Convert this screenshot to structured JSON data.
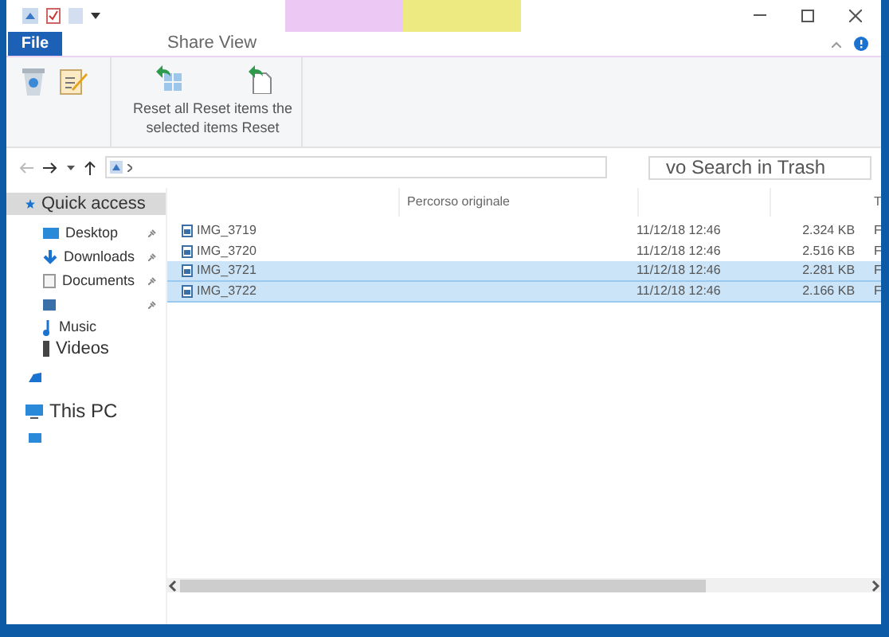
{
  "context_tabs": [
    {
      "color": "#ecc9f5"
    },
    {
      "color": "#eeea82"
    }
  ],
  "file_tab": {
    "label": "File"
  },
  "tabs": [
    {
      "label": "Share View",
      "selected": false
    }
  ],
  "ribbon": {
    "caption_lines": [
      "Reset all Reset items the",
      "selected items Reset"
    ]
  },
  "search": {
    "placeholder": "vo Search in Trash"
  },
  "nav_pane": {
    "items": [
      {
        "kind": "quick",
        "label": "Quick access",
        "selected": true
      },
      {
        "kind": "desktop",
        "label": "Desktop",
        "pinned": true,
        "selected": false
      },
      {
        "kind": "downloads",
        "label": "Downloads",
        "pinned": true,
        "selected": false
      },
      {
        "kind": "documents",
        "label": "Documents",
        "pinned": true,
        "selected": false
      },
      {
        "kind": "pictures",
        "pinned": true,
        "selected": false
      },
      {
        "kind": "music",
        "label": "Music",
        "pinned": false,
        "selected": false
      },
      {
        "kind": "videos",
        "label": "Videos",
        "pinned": false,
        "selected": false
      },
      {
        "kind": "cloud",
        "selected": false
      },
      {
        "kind": "pc",
        "label": "This PC",
        "selected": false
      },
      {
        "kind": "network",
        "selected": false
      }
    ]
  },
  "file_list": {
    "columns": [
      {},
      {
        "label": "Percorso originale"
      },
      {},
      {},
      {
        "label": "T"
      }
    ],
    "rows": [
      {
        "name": "IMG_3719",
        "date": "11/12/18 12:46",
        "size": "2.324 KB",
        "type": "F",
        "selected": false
      },
      {
        "name": "IMG_3720",
        "date": "11/12/18 12:46",
        "size": "2.516 KB",
        "type": "F",
        "selected": false
      },
      {
        "name": "IMG_3721",
        "date": "11/12/18 12:46",
        "size": "2.281 KB",
        "type": "F",
        "selected": true
      },
      {
        "name": "IMG_3722",
        "date": "11/12/18 12:46",
        "size": "2.166 KB",
        "type": "F",
        "selected": true
      }
    ]
  }
}
